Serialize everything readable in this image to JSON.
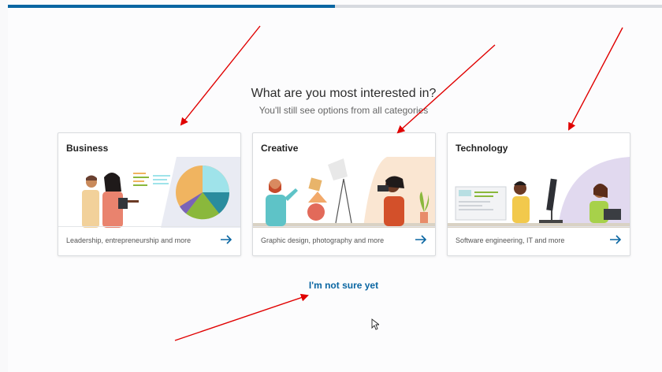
{
  "progress": {
    "value": 0.5
  },
  "heading": "What are you most interested in?",
  "subheading": "You'll still see options from all categories",
  "cards": [
    {
      "title": "Business",
      "description": "Leadership, entrepreneurship and more",
      "icon": "arrow-right-icon"
    },
    {
      "title": "Creative",
      "description": "Graphic design, photography and more",
      "icon": "arrow-right-icon"
    },
    {
      "title": "Technology",
      "description": "Software engineering, IT and more",
      "icon": "arrow-right-icon"
    }
  ],
  "not_sure_link": "I'm not sure yet",
  "colors": {
    "accent": "#0a66a2",
    "annotation_red": "#e00000",
    "progress_track": "#d7dadf"
  }
}
